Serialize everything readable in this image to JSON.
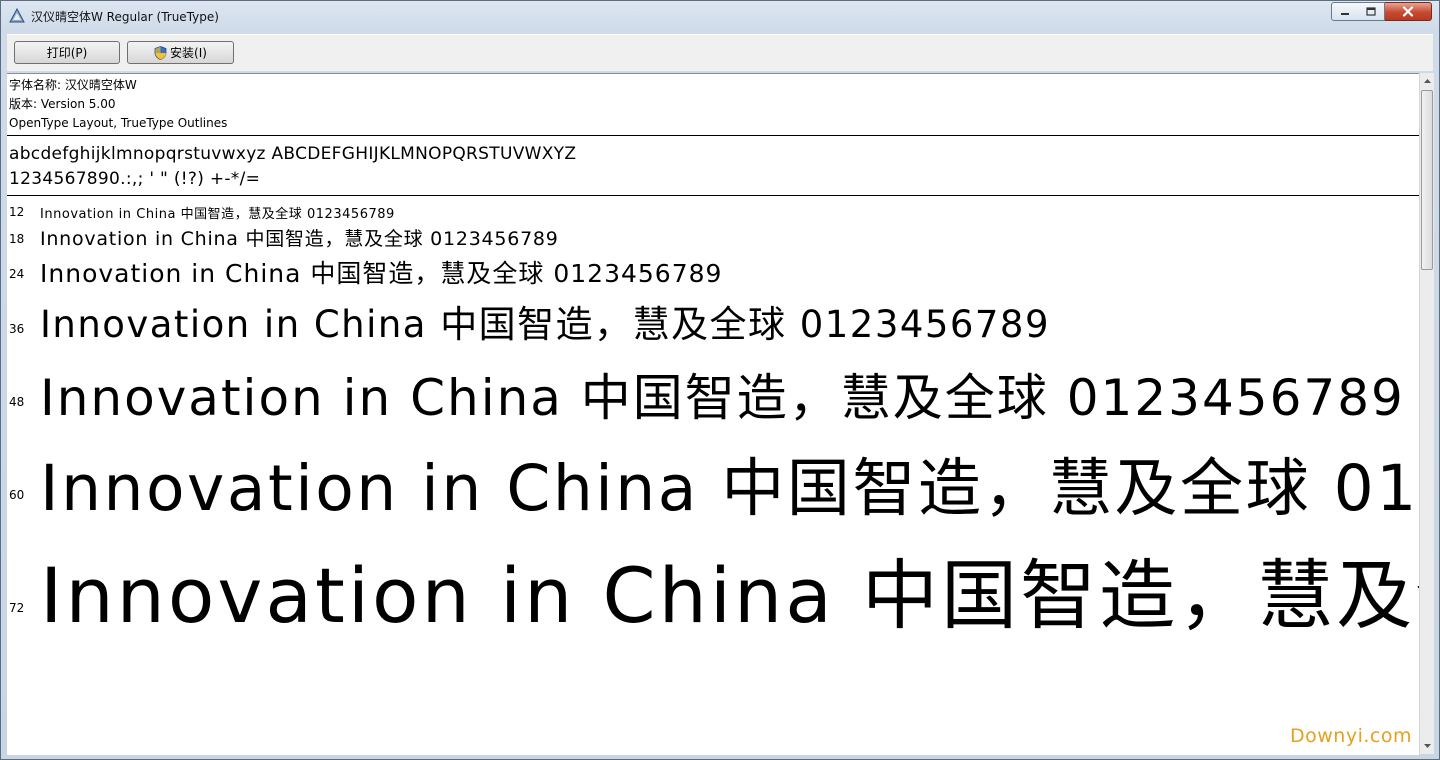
{
  "window": {
    "title": "汉仪晴空体W Regular (TrueType)",
    "controls": {
      "minimize": "minimize-icon",
      "maximize": "maximize-icon",
      "close": "close-icon"
    }
  },
  "toolbar": {
    "print_label": "打印(P)",
    "install_label": "安装(I)"
  },
  "font_info": {
    "name_line": "字体名称: 汉仪晴空体W",
    "version_line": "版本: Version 5.00",
    "type_line": "OpenType Layout, TrueType Outlines"
  },
  "charset": {
    "line1": "abcdefghijklmnopqrstuvwxyz ABCDEFGHIJKLMNOPQRSTUVWXYZ",
    "line2": "1234567890.:,; ' \" (!?) +-*/="
  },
  "sample_text": "Innovation in China 中国智造，慧及全球 0123456789",
  "samples": [
    {
      "size": "12"
    },
    {
      "size": "18"
    },
    {
      "size": "24"
    },
    {
      "size": "36"
    },
    {
      "size": "48"
    },
    {
      "size": "60"
    },
    {
      "size": "72"
    }
  ],
  "watermark": "Downyi.com",
  "colors": {
    "frame": "#c7d3e2",
    "close_button": "#c74a32",
    "watermark": "#e5a020"
  }
}
